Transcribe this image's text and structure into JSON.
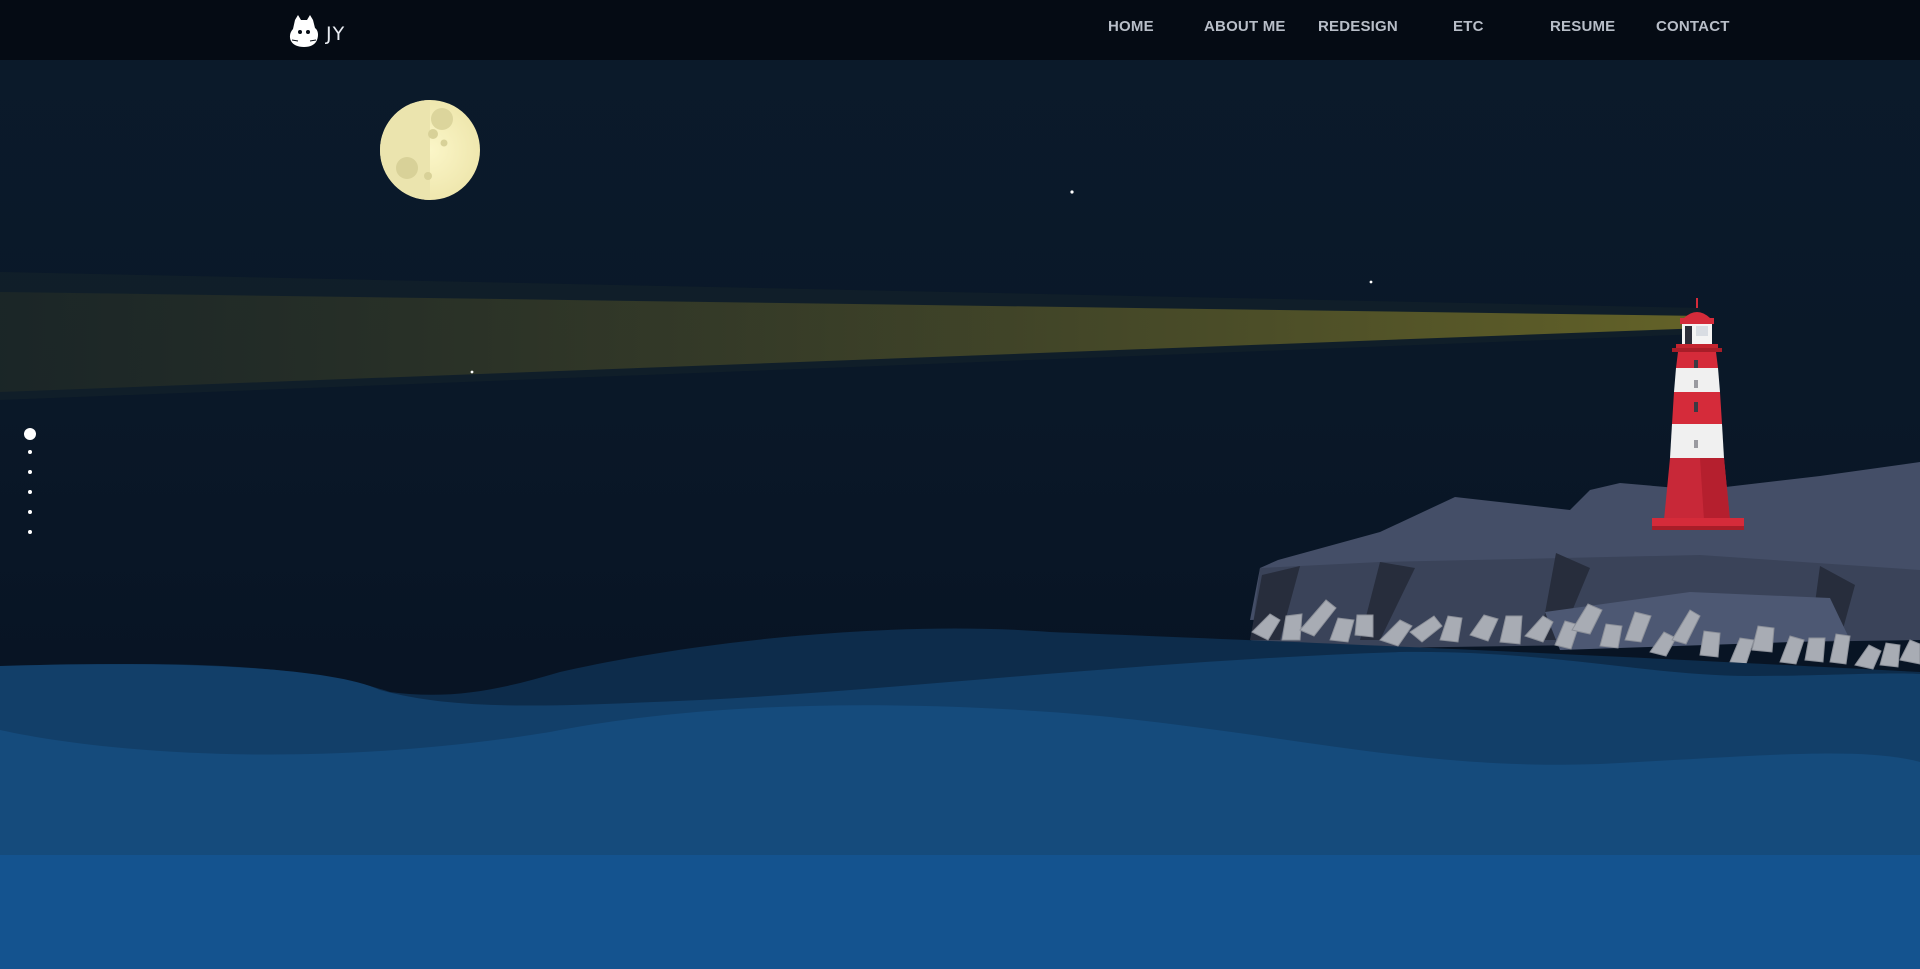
{
  "header": {
    "logo_text": "JY",
    "logo_icon": "owl-logo-icon"
  },
  "nav": {
    "items": [
      {
        "label": "HOME"
      },
      {
        "label": "ABOUT ME"
      },
      {
        "label": "REDESIGN"
      },
      {
        "label": "ETC"
      },
      {
        "label": "RESUME"
      },
      {
        "label": "CONTACT"
      }
    ]
  },
  "section_dots": {
    "count": 6,
    "active_index": 0
  },
  "colors": {
    "sky": "#0a1828",
    "navbar": "#050b14",
    "moon": "#f6f1bf",
    "beam": "#6b6a2c",
    "lighthouse_red": "#c8283a",
    "rock": "#454f68",
    "sea_deep": "#14538f"
  }
}
